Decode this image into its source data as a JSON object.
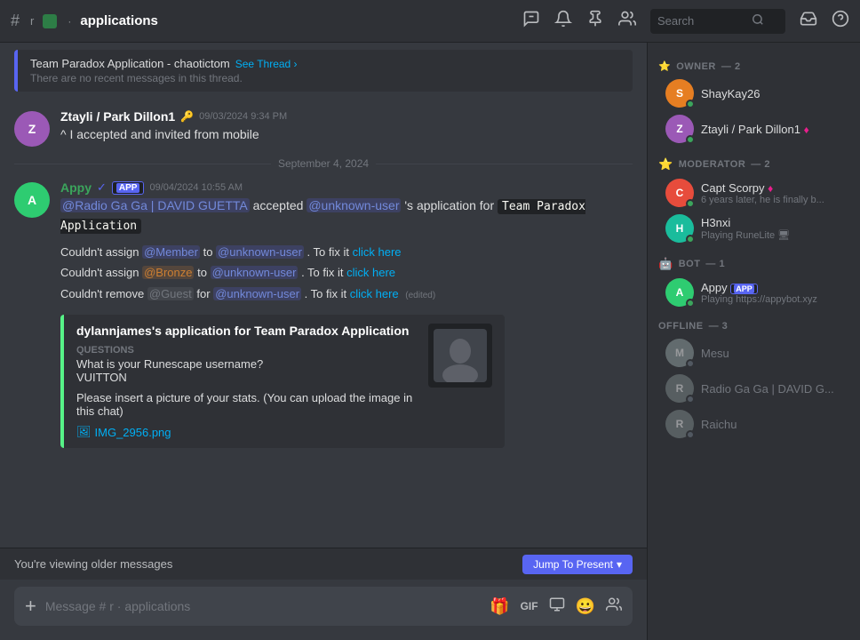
{
  "topbar": {
    "channel_icon": "#",
    "channel_prefix": "r",
    "channel_dot": "·",
    "channel_name": "applications",
    "icons": {
      "bell": "🔔",
      "pin": "📌",
      "members": "👥",
      "thread": "💬",
      "help": "?"
    },
    "search_placeholder": "Search"
  },
  "thread_banner": {
    "title": "Team Paradox Application - chaotictom",
    "link": "See Thread ›",
    "sub": "There are no recent messages in this thread."
  },
  "messages": [
    {
      "id": "msg1",
      "avatar_initials": "Z",
      "avatar_class": "av-ztayli",
      "author": "Ztayli / Park Dillon1",
      "author_class": "author-white",
      "key_icon": true,
      "timestamp": "09/03/2024 9:34 PM",
      "text": "^ I accepted and invited from mobile"
    }
  ],
  "date_separator": "September 4, 2024",
  "appy_message": {
    "avatar_initials": "A",
    "avatar_class": "av-appy",
    "author": "Appy",
    "has_verified": true,
    "has_app_badge": true,
    "app_badge_label": "APP",
    "timestamp": "09/04/2024 10:55 AM",
    "text_before": "",
    "mention_radio": "@Radio Ga Ga | DAVID GUETTA",
    "accepted_text": " accepted ",
    "mention_unknown": "@unknown-user",
    "apostrophe_s": "'s application for",
    "code_block": "Team Paradox Application"
  },
  "error_messages": [
    {
      "prefix": "Couldn't assign ",
      "mention": "@Member",
      "mention_class": "mention-member",
      "to": " to ",
      "mention2": "@unknown-user",
      "mention2_class": "",
      "fix": ". To fix it ",
      "link_text": "click here"
    },
    {
      "prefix": "Couldn't assign ",
      "mention": "@Bronze",
      "mention_class": "mention-bronze",
      "to": " to ",
      "mention2": "@unknown-user",
      "mention2_class": "",
      "fix": ". To fix it ",
      "link_text": "click here"
    },
    {
      "prefix": "Couldn't remove ",
      "mention": "@Guest",
      "mention_class": "mention-guest",
      "to": " for ",
      "mention2": "@unknown-user",
      "mention2_class": "",
      "fix": ". To fix it ",
      "link_text": "click here",
      "edited": "(edited)"
    }
  ],
  "embed": {
    "title": "dylannjames's application for Team Paradox Application",
    "section1_label": "Questions",
    "section1_q": "What is your Runescape username?",
    "section1_a": "VUITTON",
    "section2_q": "Please insert a picture of your stats. (You can upload the image in this chat)",
    "attachment_icon": "🖼",
    "attachment_name": "IMG_2956.png"
  },
  "older_bar": {
    "text": "You're viewing older messages",
    "jump_label": "Jump To Present",
    "jump_chevron": "▾"
  },
  "input": {
    "placeholder": "Message # r · applications",
    "add_icon": "+",
    "gift_icon": "🎁",
    "gif_label": "GIF",
    "sticker_icon": "🗒",
    "emoji_icon": "😀",
    "people_icon": "👥"
  },
  "sidebar": {
    "owner_label": "OWNER",
    "owner_count": "2",
    "moderator_label": "MODERATOR",
    "moderator_count": "2",
    "bot_label": "BOT",
    "bot_count": "1",
    "offline_label": "OFFLINE",
    "offline_count": "3",
    "members": {
      "owners": [
        {
          "name": "ShayKay26",
          "status": "online",
          "avatar_class": "av-shaykay",
          "initials": "S",
          "has_crown": false,
          "sub_badge": "●"
        },
        {
          "name": "Ztayli / Park Dillon1",
          "status": "online",
          "avatar_class": "av-ztayli",
          "initials": "Z",
          "has_pink_dot": true
        }
      ],
      "moderators": [
        {
          "name": "Capt Scorpy",
          "status": "online",
          "avatar_class": "av-capt",
          "initials": "C",
          "has_pink_dot": true,
          "status_text": "6 years later, he is finally b..."
        },
        {
          "name": "H3nxi",
          "status": "online",
          "avatar_class": "av-h3nxi",
          "initials": "H",
          "status_text": "Playing RuneLite 🖥"
        }
      ],
      "bots": [
        {
          "name": "Appy",
          "status": "online",
          "avatar_class": "av-appy",
          "initials": "A",
          "has_app_badge": true,
          "status_text": "Playing https://appybot.xyz"
        }
      ],
      "offline": [
        {
          "name": "Mesu",
          "status": "offline",
          "avatar_class": "av-mesu",
          "initials": "M"
        },
        {
          "name": "Radio Ga Ga | DAVID G...",
          "status": "offline",
          "avatar_class": "av-radio",
          "initials": "R"
        },
        {
          "name": "Raichu",
          "status": "offline",
          "avatar_class": "av-raichu",
          "initials": "R2"
        }
      ]
    }
  }
}
